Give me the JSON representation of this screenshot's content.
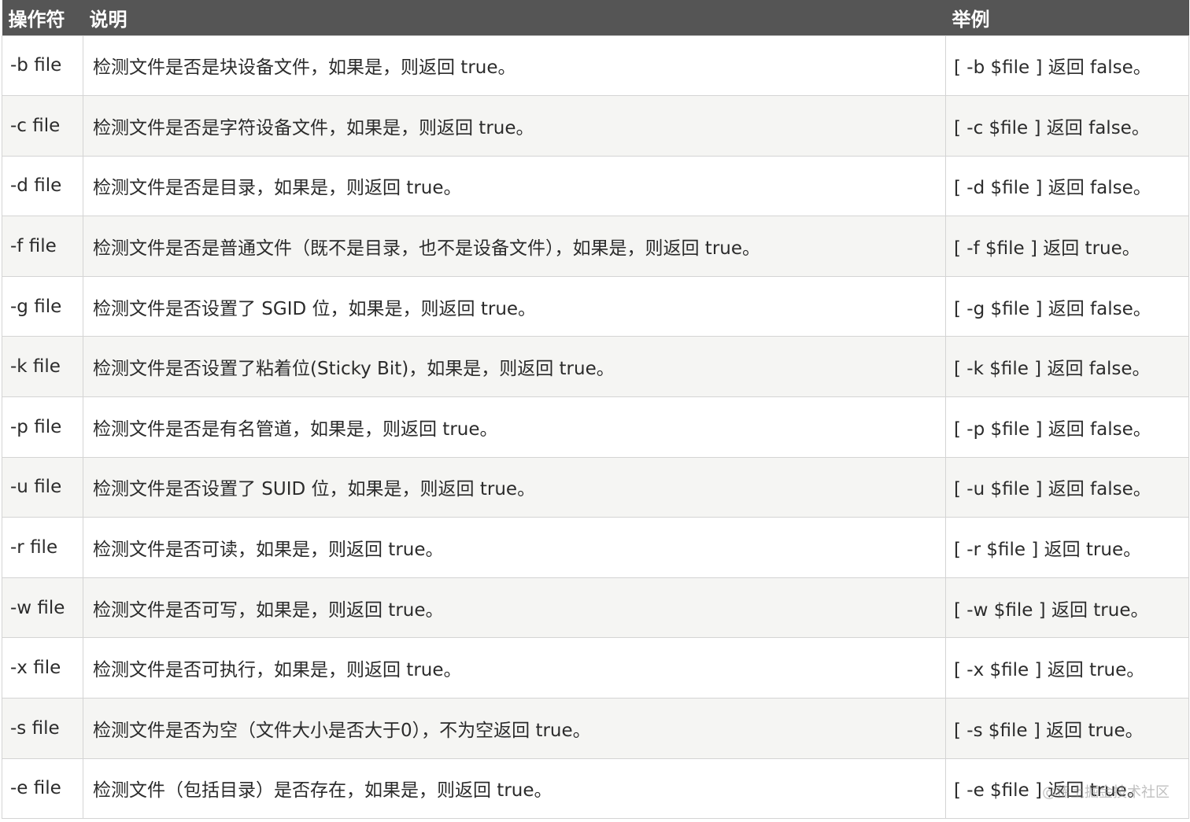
{
  "header": {
    "col_op": "操作符",
    "col_desc": "说明",
    "col_example": "举例"
  },
  "rows": [
    {
      "op": "-b file",
      "desc": "检测文件是否是块设备文件，如果是，则返回 true。",
      "example": "[ -b $file ] 返回 false。"
    },
    {
      "op": "-c file",
      "desc": "检测文件是否是字符设备文件，如果是，则返回 true。",
      "example": "[ -c $file ] 返回 false。"
    },
    {
      "op": "-d file",
      "desc": "检测文件是否是目录，如果是，则返回 true。",
      "example": "[ -d $file ] 返回 false。"
    },
    {
      "op": "-f file",
      "desc": "检测文件是否是普通文件（既不是目录，也不是设备文件），如果是，则返回 true。",
      "example": "[ -f $file ] 返回 true。"
    },
    {
      "op": "-g file",
      "desc": "检测文件是否设置了 SGID 位，如果是，则返回 true。",
      "example": "[ -g $file ] 返回 false。"
    },
    {
      "op": "-k file",
      "desc": "检测文件是否设置了粘着位(Sticky Bit)，如果是，则返回 true。",
      "example": "[ -k $file ] 返回 false。"
    },
    {
      "op": "-p file",
      "desc": "检测文件是否是有名管道，如果是，则返回 true。",
      "example": "[ -p $file ] 返回 false。"
    },
    {
      "op": "-u file",
      "desc": "检测文件是否设置了 SUID 位，如果是，则返回 true。",
      "example": "[ -u $file ] 返回 false。"
    },
    {
      "op": "-r file",
      "desc": "检测文件是否可读，如果是，则返回 true。",
      "example": "[ -r $file ] 返回 true。"
    },
    {
      "op": "-w file",
      "desc": "检测文件是否可写，如果是，则返回 true。",
      "example": "[ -w $file ] 返回 true。"
    },
    {
      "op": "-x file",
      "desc": "检测文件是否可执行，如果是，则返回 true。",
      "example": "[ -x $file ] 返回 true。"
    },
    {
      "op": "-s file",
      "desc": "检测文件是否为空（文件大小是否大于0），不为空返回 true。",
      "example": "[ -s $file ] 返回 true。"
    },
    {
      "op": "-e file",
      "desc": "检测文件（包括目录）是否存在，如果是，则返回 true。",
      "example": "[ -e $file ] 返回 true。"
    }
  ],
  "watermark": "@稀土掘金技术社区"
}
